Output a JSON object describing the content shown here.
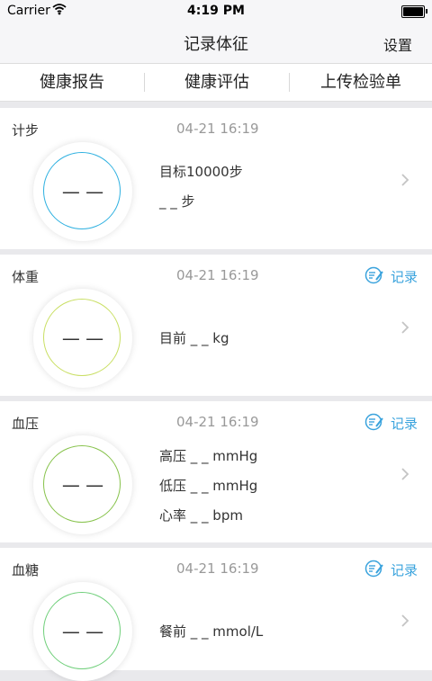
{
  "status_bar": {
    "carrier": "Carrier",
    "time": "4:19 PM"
  },
  "nav": {
    "title": "记录体征",
    "settings_label": "设置"
  },
  "tabs": [
    {
      "label": "健康报告"
    },
    {
      "label": "健康评估"
    },
    {
      "label": "上传检验单"
    }
  ],
  "cards": [
    {
      "title": "计步",
      "time": "04-21 16:19",
      "gauge_value": "— —",
      "ring_color": "#2db0e0",
      "metrics": [
        "目标10000步",
        "_ _ 步"
      ]
    },
    {
      "title": "体重",
      "time": "04-21 16:19",
      "record_label": "记录",
      "gauge_value": "— —",
      "ring_color": "#c9df63",
      "metrics": [
        "目前 _ _ kg"
      ]
    },
    {
      "title": "血压",
      "time": "04-21 16:19",
      "record_label": "记录",
      "gauge_value": "— —",
      "ring_color": "#86c24a",
      "metrics": [
        "高压 _ _ mmHg",
        "低压 _ _ mmHg",
        "心率 _ _ bpm"
      ]
    },
    {
      "title": "血糖",
      "time": "04-21 16:19",
      "record_label": "记录",
      "gauge_value": "— —",
      "ring_color": "#6fcf7a",
      "metrics": [
        "餐前 _ _ mmol/L"
      ]
    }
  ],
  "colors": {
    "accent": "#3aa3dd",
    "background": "#e9e9ec"
  }
}
